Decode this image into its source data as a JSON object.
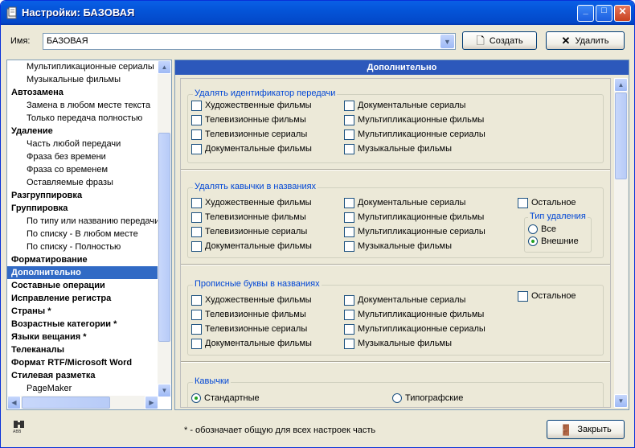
{
  "window": {
    "title": "Настройки: БАЗОВАЯ",
    "minimize": "_",
    "maximize": "□",
    "close": "✕"
  },
  "name_row": {
    "label": "Имя:",
    "value": "БАЗОВАЯ",
    "create_label": "Создать",
    "delete_label": "Удалить"
  },
  "tree": {
    "items": [
      {
        "label": "Мультипликационные сериалы",
        "bold": false
      },
      {
        "label": "Музыкальные фильмы",
        "bold": false
      },
      {
        "label": "Автозамена",
        "bold": true
      },
      {
        "label": "Замена в любом месте текста",
        "bold": false
      },
      {
        "label": "Только передача полностью",
        "bold": false
      },
      {
        "label": "Удаление",
        "bold": true
      },
      {
        "label": "Часть любой передачи",
        "bold": false
      },
      {
        "label": "Фраза без времени",
        "bold": false
      },
      {
        "label": "Фраза со временем",
        "bold": false
      },
      {
        "label": "Оставляемые фразы",
        "bold": false
      },
      {
        "label": "Разгруппировка",
        "bold": true
      },
      {
        "label": "Группировка",
        "bold": true
      },
      {
        "label": "По типу или названию передачи",
        "bold": false
      },
      {
        "label": "По списку - В любом месте",
        "bold": false
      },
      {
        "label": "По списку - Полностью",
        "bold": false
      },
      {
        "label": "Форматирование",
        "bold": true
      },
      {
        "label": "Дополнительно",
        "bold": true,
        "selected": true
      },
      {
        "label": "Составные операции",
        "bold": true
      },
      {
        "label": "Исправление регистра",
        "bold": true
      },
      {
        "label": "Страны *",
        "bold": true
      },
      {
        "label": "Возрастные категории *",
        "bold": true
      },
      {
        "label": "Языки вещания *",
        "bold": true
      },
      {
        "label": "Телеканалы",
        "bold": true
      },
      {
        "label": "Формат RTF/Microsoft Word",
        "bold": true
      },
      {
        "label": "Стилевая разметка",
        "bold": true
      },
      {
        "label": "PageMaker",
        "bold": false
      }
    ]
  },
  "right": {
    "header": "Дополнительно"
  },
  "groups": [
    {
      "title": "Удалять идентификатор передачи",
      "col1": [
        "Художественные фильмы",
        "Телевизионные фильмы",
        "Телевизионные сериалы",
        "Документальные фильмы"
      ],
      "col2": [
        "Документальные сериалы",
        "Мультипликационные фильмы",
        "Мультипликационные сериалы",
        "Музыкальные фильмы"
      ]
    },
    {
      "title": "Удалять кавычки в названиях",
      "col1": [
        "Художественные фильмы",
        "Телевизионные фильмы",
        "Телевизионные сериалы",
        "Документальные фильмы"
      ],
      "col2": [
        "Документальные сериалы",
        "Мультипликационные фильмы",
        "Мультипликационные сериалы",
        "Музыкальные фильмы"
      ],
      "other": "Остальное",
      "delete_type": {
        "title": "Тип удаления",
        "opt1": "Все",
        "opt2": "Внешние",
        "selected": "Внешние"
      }
    },
    {
      "title": "Прописные буквы в названиях",
      "col1": [
        "Художественные фильмы",
        "Телевизионные фильмы",
        "Телевизионные сериалы",
        "Документальные фильмы"
      ],
      "col2": [
        "Документальные сериалы",
        "Мультипликационные фильмы",
        "Мультипликационные сериалы",
        "Музыкальные фильмы"
      ],
      "other": "Остальное"
    }
  ],
  "quotes": {
    "title": "Кавычки",
    "opt1": "Стандартные",
    "opt2": "Типографские",
    "selected": "Стандартные"
  },
  "footer": {
    "note": "* - обозначает общую для всех настроек часть",
    "close_label": "Закрыть"
  }
}
